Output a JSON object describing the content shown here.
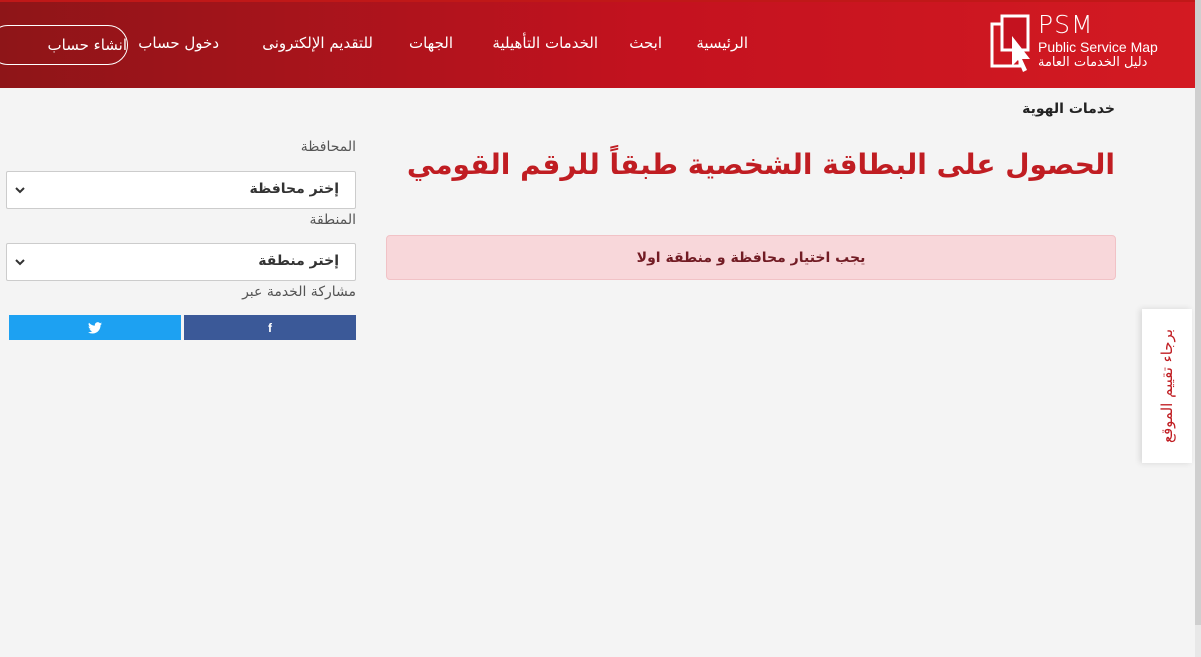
{
  "brand": {
    "logo_text": "PSM",
    "subtitle_en": "Public Service Map",
    "subtitle_ar": "دليل الخدمات العامة"
  },
  "nav": {
    "home": "الرئيسية",
    "search": "ابحث",
    "qualifying_services": "الخدمات التأهيلية",
    "entities": "الجهات",
    "e_apply": "للتقديم الإلكترونى",
    "login": "دخول حساب",
    "signup": "انشاء حساب"
  },
  "breadcrumb": "خدمات الهوية",
  "title": "الحصول على البطاقة الشخصية طبقاً للرقم القومي",
  "alert": "يجب اختيار محافظة و منطقة اولا",
  "sidebar": {
    "governorate_label": "المحافظة",
    "governorate_value": "إختر محافظة",
    "region_label": "المنطقة",
    "region_value": "إختر منطقة",
    "share_label": "مشاركة الخدمة عبر",
    "facebook_icon": "f",
    "twitter_icon": "twitter-bird"
  },
  "rate_tab": "برجاء تقييم الموقع",
  "colors": {
    "brand_red": "#c4121f",
    "title_red": "#c01d22",
    "alert_bg": "#f8d7da",
    "facebook": "#3b5998",
    "twitter": "#1da1f2"
  }
}
